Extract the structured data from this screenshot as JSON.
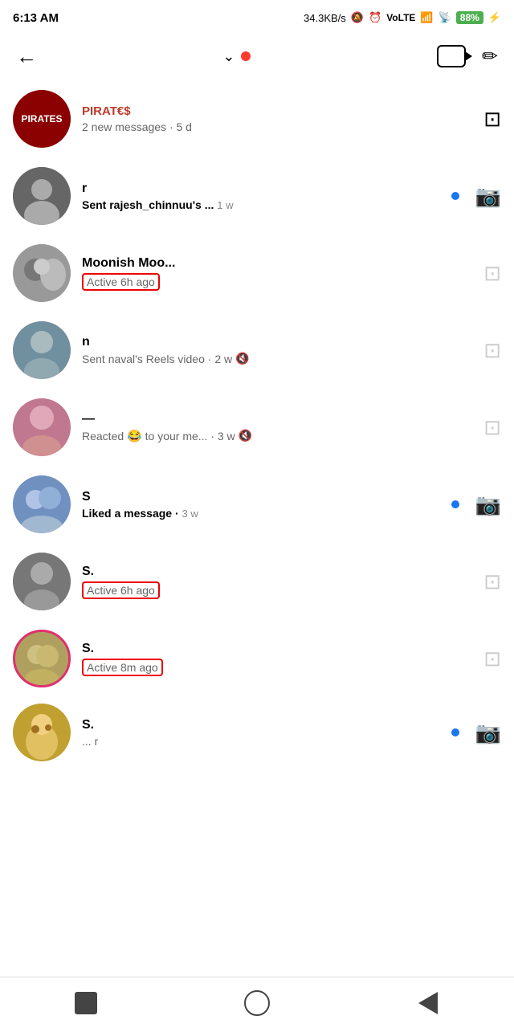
{
  "statusBar": {
    "time": "6:13 AM",
    "network": "34.3KB/s",
    "battery": "88",
    "icons": [
      "wifi-icon",
      "alarm-icon",
      "video-te-icon",
      "signal-icon",
      "wifi-icon2",
      "battery-icon"
    ]
  },
  "topNav": {
    "backLabel": "←",
    "chevronLabel": "⌄",
    "videoButtonLabel": "",
    "composeLabel": "✏"
  },
  "conversations": [
    {
      "id": "conv-pirates",
      "name": "PIRATES",
      "nameHidden": false,
      "subText": "2 new messages",
      "time": "5 d",
      "avatarClass": "av-pirates",
      "avatarEmoji": "",
      "avatarLabel": "PIRATES",
      "hasUnread": false,
      "hasCameraActive": false,
      "hasMute": false,
      "subBold": false,
      "activeBox": false
    },
    {
      "id": "conv-rajesh",
      "name": "r",
      "nameHidden": true,
      "subText": "Sent rajesh_chinnuu's ...",
      "time": "1 w",
      "avatarClass": "av-1",
      "avatarEmoji": "👨",
      "avatarLabel": "",
      "hasUnread": true,
      "hasCameraActive": true,
      "hasMute": false,
      "subBold": true,
      "activeBox": false
    },
    {
      "id": "conv-moonis",
      "name": "Moonish Moo...",
      "nameHidden": true,
      "subText": "Active 6h ago",
      "time": "",
      "avatarClass": "av-2",
      "avatarEmoji": "🏍",
      "avatarLabel": "",
      "hasUnread": false,
      "hasCameraActive": false,
      "hasMute": false,
      "subBold": false,
      "activeBox": true
    },
    {
      "id": "conv-naval",
      "name": "n",
      "nameHidden": true,
      "subText": "Sent naval's Reels video",
      "time": "2 w",
      "avatarClass": "av-3",
      "avatarEmoji": "👦",
      "avatarLabel": "",
      "hasUnread": false,
      "hasCameraActive": false,
      "hasMute": true,
      "subBold": false,
      "activeBox": false
    },
    {
      "id": "conv-reacted",
      "name": "—",
      "nameHidden": true,
      "subText": "Reacted 😂 to your me...",
      "subEmoji": "😂",
      "time": "3 w",
      "avatarClass": "av-6",
      "avatarEmoji": "👩",
      "avatarLabel": "",
      "hasUnread": false,
      "hasCameraActive": false,
      "hasMute": true,
      "subBold": false,
      "activeBox": false
    },
    {
      "id": "conv-liked",
      "name": "S",
      "nameHidden": true,
      "subText": "Liked a message",
      "time": "3 w",
      "avatarClass": "av-4",
      "avatarEmoji": "👫",
      "avatarLabel": "",
      "hasUnread": true,
      "hasCameraActive": true,
      "hasMute": false,
      "subBold": true,
      "activeBox": false
    },
    {
      "id": "conv-s1",
      "name": "S.",
      "nameHidden": true,
      "subText": "Active 6h ago",
      "time": "",
      "avatarClass": "av-5",
      "avatarEmoji": "👨",
      "avatarLabel": "",
      "hasUnread": false,
      "hasCameraActive": false,
      "hasMute": false,
      "subBold": false,
      "activeBox": true
    },
    {
      "id": "conv-s2",
      "name": "S.",
      "nameHidden": true,
      "subText": "Active 8m ago",
      "time": "",
      "avatarClass": "av-7",
      "avatarEmoji": "💑",
      "avatarLabel": "",
      "hasUnread": false,
      "hasCameraActive": false,
      "hasMute": false,
      "subBold": false,
      "activeBox": true,
      "hasStoryRing": true
    },
    {
      "id": "conv-s3",
      "name": "S.",
      "nameHidden": true,
      "subText": "...",
      "time": "r",
      "avatarClass": "av-8",
      "avatarEmoji": "🐞",
      "avatarLabel": "",
      "hasUnread": true,
      "hasCameraActive": true,
      "hasMute": false,
      "subBold": false,
      "activeBox": false
    }
  ],
  "bottomNav": {
    "stopLabel": "■",
    "homeLabel": "○",
    "backLabel": "◄"
  }
}
